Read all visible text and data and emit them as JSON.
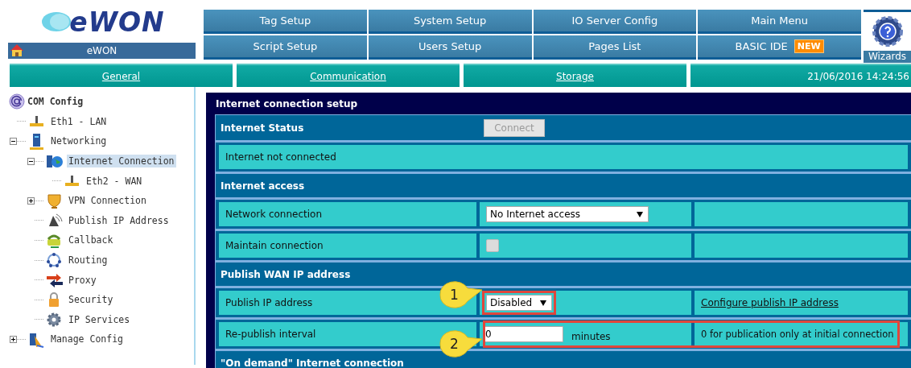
{
  "header": {
    "logo": "eWON",
    "device": "eWON",
    "wizards": "Wizards",
    "nav": [
      {
        "label": "Tag Setup"
      },
      {
        "label": "System Setup"
      },
      {
        "label": "IO Server Config"
      },
      {
        "label": "Main Menu"
      },
      {
        "label": "Script Setup"
      },
      {
        "label": "Users Setup"
      },
      {
        "label": "Pages List"
      },
      {
        "label": "BASIC IDE",
        "badge": "NEW"
      }
    ]
  },
  "tabs": [
    {
      "label": "General"
    },
    {
      "label": "Communication"
    },
    {
      "label": "Storage"
    }
  ],
  "date": "21/06/2016 14:24:56",
  "tree": {
    "label": "COM Config",
    "children": [
      {
        "label": "Eth1 - LAN",
        "selected": false
      },
      {
        "label": "Networking",
        "selected": false,
        "expanded": true,
        "children": [
          {
            "label": "Internet Connection",
            "selected": true,
            "expanded": true,
            "children": [
              {
                "label": "Eth2 - WAN",
                "selected": false
              }
            ]
          },
          {
            "label": "VPN Connection",
            "selected": false,
            "expanded": false
          },
          {
            "label": "Publish IP Address",
            "selected": false
          },
          {
            "label": "Callback",
            "selected": false
          },
          {
            "label": "Routing",
            "selected": false
          },
          {
            "label": "Proxy",
            "selected": false
          },
          {
            "label": "Security",
            "selected": false
          },
          {
            "label": "IP Services",
            "selected": false
          }
        ]
      },
      {
        "label": "Manage Config",
        "selected": false,
        "expanded": false
      }
    ]
  },
  "panel": {
    "title": "Internet connection setup",
    "rows": [
      {
        "kind": "section",
        "label": "Internet Status",
        "button": {
          "label": "Connect",
          "disabled": true
        }
      },
      {
        "kind": "status",
        "text": "Internet not connected"
      },
      {
        "kind": "section",
        "label": "Internet access"
      },
      {
        "kind": "field",
        "label": "Network connection",
        "control": {
          "kind": "select",
          "value": "No Internet access",
          "highlighted": false
        }
      },
      {
        "kind": "field",
        "label": "Maintain connection",
        "control": {
          "kind": "checkbox",
          "checked": false,
          "disabled": true
        }
      },
      {
        "kind": "section",
        "label": "Publish WAN IP address"
      },
      {
        "kind": "field",
        "label": "Publish IP address",
        "callout": "1",
        "control": {
          "kind": "select",
          "value": "Disabled",
          "highlighted": true
        },
        "note": {
          "kind": "link",
          "text": "Configure publish IP address"
        }
      },
      {
        "kind": "field",
        "label": "Re-publish interval",
        "callout": "2",
        "highlighted": true,
        "control": {
          "kind": "input",
          "value": "0",
          "unit": "minutes"
        },
        "note": {
          "kind": "text",
          "text": "0 for publication only at initial connection"
        }
      },
      {
        "kind": "section",
        "label": "\"On demand\" Internet connection"
      }
    ]
  }
}
